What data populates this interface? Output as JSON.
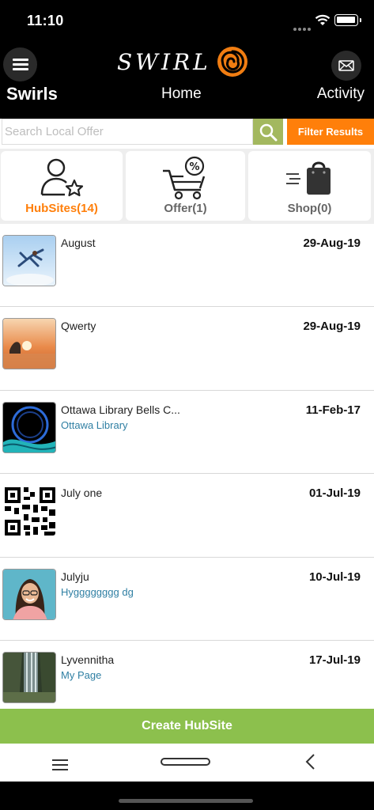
{
  "status": {
    "time": "11:10"
  },
  "header": {
    "logo": "SWIRL",
    "title": "Swirls",
    "home": "Home",
    "activity": "Activity"
  },
  "search": {
    "placeholder": "Search Local Offer",
    "filter_label": "Filter Results"
  },
  "tabs": [
    {
      "label": "HubSites(14)",
      "icon": "user-star-icon"
    },
    {
      "label": "Offer(1)",
      "icon": "cart-percent-icon"
    },
    {
      "label": "Shop(0)",
      "icon": "shopping-bag-icon"
    }
  ],
  "items": [
    {
      "name": "August",
      "sub": "",
      "date": "29-Aug-19"
    },
    {
      "name": "Qwerty",
      "sub": "",
      "date": "29-Aug-19"
    },
    {
      "name": "Ottawa Library Bells C...",
      "sub": "Ottawa Library",
      "date": "11-Feb-17"
    },
    {
      "name": "July one",
      "sub": "",
      "date": "01-Jul-19"
    },
    {
      "name": "Julyju",
      "sub": "Hygggggggg dg",
      "date": "10-Jul-19"
    },
    {
      "name": "Lyvennitha",
      "sub": "My Page",
      "date": "17-Jul-19"
    }
  ],
  "create_label": "Create HubSite",
  "colors": {
    "accent": "#ff7f0a",
    "search_btn": "#a3b85f",
    "create": "#8cc04d",
    "link": "#2f7fa3"
  }
}
